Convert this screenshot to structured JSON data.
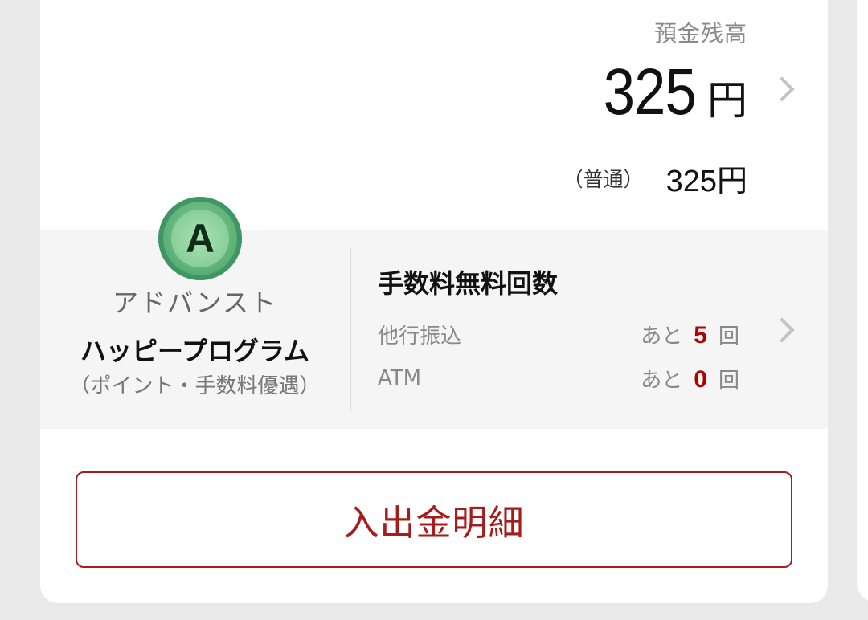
{
  "balance": {
    "label": "預金残高",
    "amount": "325",
    "unit": "円",
    "account_type": "（普通）",
    "account_amount": "325円"
  },
  "program": {
    "badge_letter": "A",
    "tier": "アドバンスト",
    "name": "ハッピープログラム",
    "note": "（ポイント・手数料優遇）"
  },
  "fees": {
    "title": "手数料無料回数",
    "rows": [
      {
        "label": "他行振込",
        "prefix": "あと",
        "count": "5",
        "suffix": "回"
      },
      {
        "label": "ATM",
        "prefix": "あと",
        "count": "0",
        "suffix": "回"
      }
    ]
  },
  "actions": {
    "history_label": "入出金明細"
  },
  "colors": {
    "accent": "#a61b1b",
    "count_highlight": "#b20000",
    "badge_green": "#5fb27a"
  }
}
